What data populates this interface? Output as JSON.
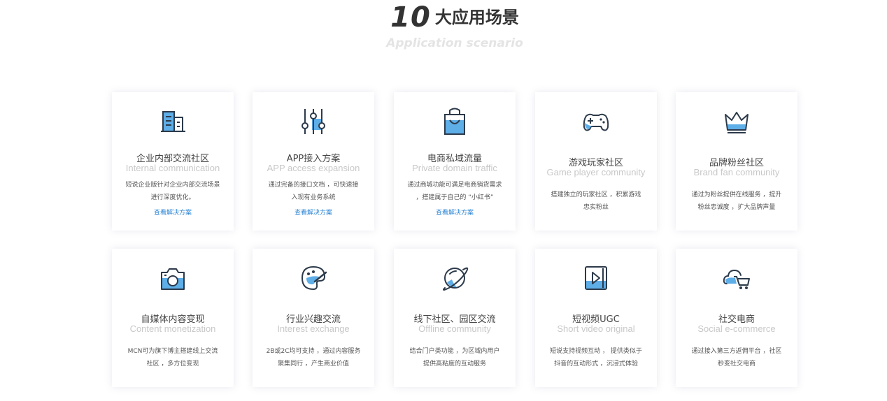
{
  "section": {
    "number": "10",
    "title": "大应用场景",
    "subtitle": "Application scenario"
  },
  "colors": {
    "accent": "#2d86d6",
    "icon_fill": "#5eaee8",
    "icon_stroke": "#2c3a4a"
  },
  "cards": [
    {
      "icon": "building-icon",
      "title": "企业内部交流社区",
      "en": "Internal communication",
      "desc": [
        "短说企业版针对企业内部交流场景",
        "进行深度优化。"
      ],
      "link": "查看解决方案"
    },
    {
      "icon": "sliders-icon",
      "title": "APP接入方案",
      "en": "APP access expansion",
      "desc": [
        "通过完备的接口文档 ，可快速接",
        "入现有业务系统"
      ],
      "link": "查看解决方案"
    },
    {
      "icon": "shopping-bag-icon",
      "title": "电商私域流量",
      "en": "Private domain traffic",
      "desc": [
        "通过商城功能可满足电商销货需求",
        "，搭建属于自己的 “小红书”"
      ],
      "link": "查看解决方案"
    },
    {
      "icon": "gamepad-icon",
      "title": "游戏玩家社区",
      "en": "Game player community",
      "desc": [
        "搭建独立的玩家社区 ，积累游戏",
        "忠实粉丝"
      ],
      "link": ""
    },
    {
      "icon": "crown-icon",
      "title": "品牌粉丝社区",
      "en": "Brand fan community",
      "desc": [
        "通过为粉丝提供在线服务 ，提升",
        "粉丝忠诚度 ，扩大品牌声量"
      ],
      "link": ""
    },
    {
      "icon": "camera-icon",
      "title": "自媒体内容变现",
      "en": "Content monetization",
      "desc": [
        "MCN可为旗下博主搭建线上交流",
        "社区 ，多方位变现"
      ],
      "link": ""
    },
    {
      "icon": "palette-icon",
      "title": "行业兴趣交流",
      "en": "Interest exchange",
      "desc": [
        "2B或2C均可支持 ，通过内容服务",
        "聚集同行 ，产生商业价值"
      ],
      "link": ""
    },
    {
      "icon": "planet-icon",
      "title": "线下社区、园区交流",
      "en": "Offline community",
      "desc": [
        "结合门户类功能 ，为区域内用户",
        "提供高粘度的互动服务"
      ],
      "link": ""
    },
    {
      "icon": "video-play-icon",
      "title": "短视频UGC",
      "en": "Short video original",
      "desc": [
        "短说支持视频互动 ， 提供类似于",
        "抖音的互动形式 ，沉浸式体验"
      ],
      "link": ""
    },
    {
      "icon": "cloud-cart-icon",
      "title": "社交电商",
      "en": "Social e-commerce",
      "desc": [
        "通过接入第三方返佣平台 ，社区",
        "秒变社交电商"
      ],
      "link": ""
    }
  ]
}
